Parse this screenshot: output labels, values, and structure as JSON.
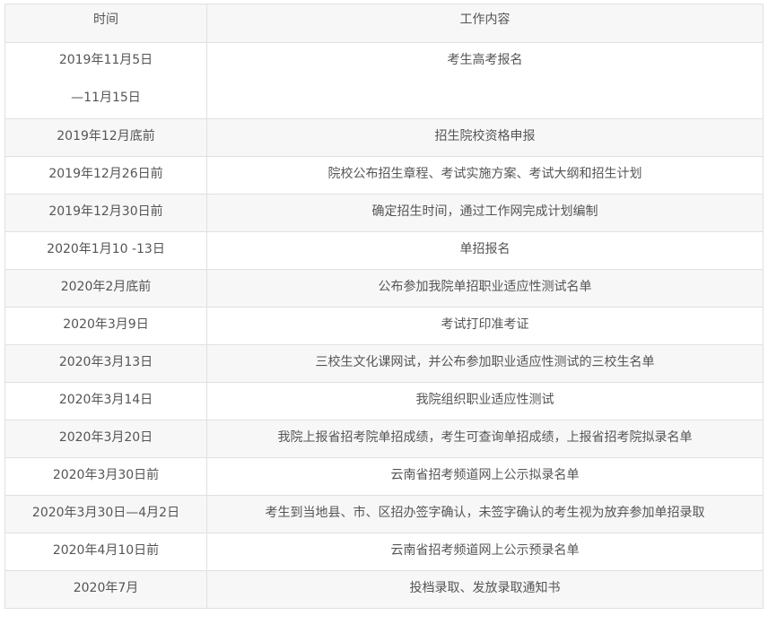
{
  "table": {
    "headers": [
      "时间",
      "工作内容"
    ],
    "first_row": {
      "time_line1": "2019年11月5日",
      "time_line2": "—11月15日",
      "work": "考生高考报名"
    },
    "rows": [
      {
        "time": "2019年12月底前",
        "work": "招生院校资格申报"
      },
      {
        "time": "2019年12月26日前",
        "work": "院校公布招生章程、考试实施方案、考试大纲和招生计划"
      },
      {
        "time": "2019年12月30日前",
        "work": "确定招生时间，通过工作网完成计划编制"
      },
      {
        "time": "2020年1月10 -13日",
        "work": "单招报名"
      },
      {
        "time": "2020年2月底前",
        "work": "公布参加我院单招职业适应性测试名单"
      },
      {
        "time": "2020年3月9日",
        "work": "考试打印准考证"
      },
      {
        "time": "2020年3月13日",
        "work": "三校生文化课网试，并公布参加职业适应性测试的三校生名单"
      },
      {
        "time": "2020年3月14日",
        "work": "我院组织职业适应性测试"
      },
      {
        "time": "2020年3月20日",
        "work": "我院上报省招考院单招成绩，考生可查询单招成绩，上报省招考院拟录名单"
      },
      {
        "time": "2020年3月30日前",
        "work": "云南省招考频道网上公示拟录名单"
      },
      {
        "time": "2020年3月30日—4月2日",
        "work": "考生到当地县、市、区招办签字确认，未签字确认的考生视为放弃参加单招录取"
      },
      {
        "time": "2020年4月10日前",
        "work": "云南省招考频道网上公示预录名单"
      },
      {
        "time": "2020年7月",
        "work": "投档录取、发放录取通知书"
      }
    ]
  }
}
